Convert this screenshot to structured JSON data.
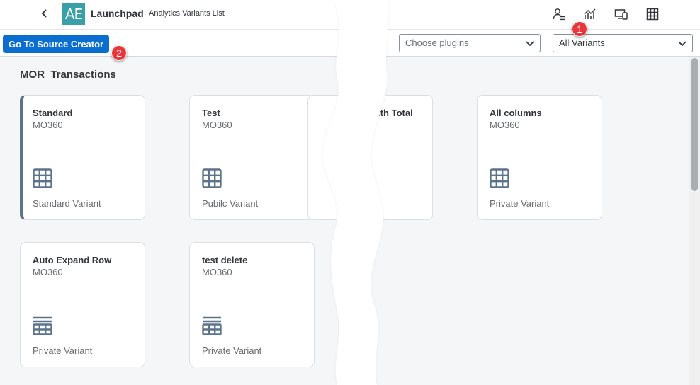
{
  "shell": {
    "app_title": "Launchpad",
    "app_subtitle": "Analytics Variants List",
    "logo_text": "AE",
    "icons": [
      "back-icon",
      "user-settings-icon",
      "analytics-icon",
      "devices-icon",
      "grid-icon"
    ]
  },
  "toolbar": {
    "source_button_label": "Go To Source Creator",
    "plugins_placeholder": "Choose plugins",
    "variants_selected": "All Variants"
  },
  "badges": {
    "one": "1",
    "two": "2"
  },
  "section": {
    "title": "MOR_Transactions"
  },
  "cards": [
    {
      "title": "Standard",
      "subtitle": "MO360",
      "footer": "Standard Variant",
      "icon": "table-icon"
    },
    {
      "title": "Test",
      "subtitle": "MO360",
      "footer": "Pubilc Variant",
      "icon": "table-icon"
    },
    {
      "title": "with Total",
      "subtitle": "",
      "footer": "",
      "icon": ""
    },
    {
      "title": "All columns",
      "subtitle": "MO360",
      "footer": "Private Variant",
      "icon": "table-icon"
    },
    {
      "title": "Auto Expand Row",
      "subtitle": "MO360",
      "footer": "Private Variant",
      "icon": "list-table-icon"
    },
    {
      "title": "test delete",
      "subtitle": "MO360",
      "footer": "Private Variant",
      "icon": "list-table-icon"
    }
  ],
  "colors": {
    "accent": "#0a6ed1",
    "badge": "#e8363a",
    "selected_border": "#5b738b",
    "logo": "#3aa0a8"
  }
}
